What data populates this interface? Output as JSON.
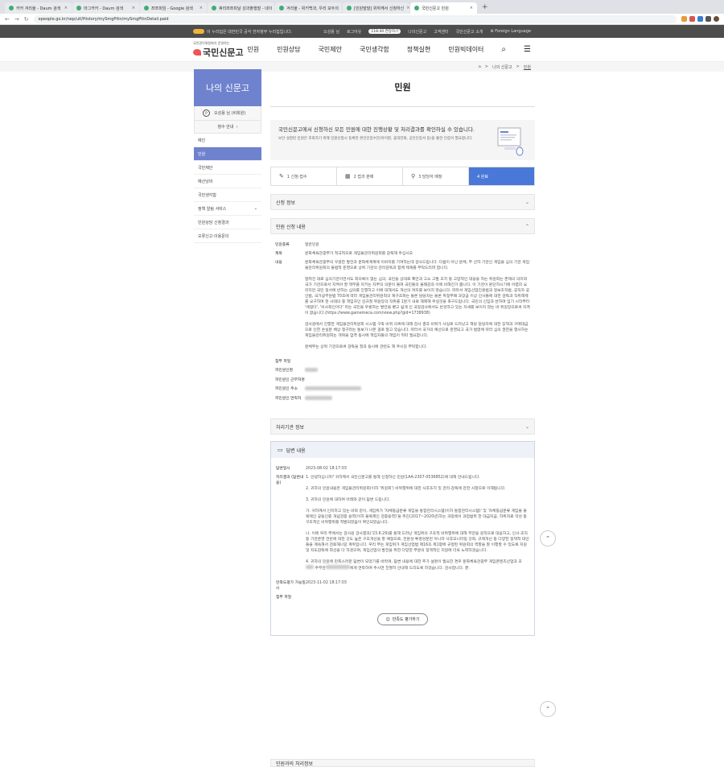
{
  "browser": {
    "tabs": [
      {
        "label": "카카 겨리울 - Daum 검색"
      },
      {
        "label": "마그카카 - Daum 검색"
      },
      {
        "label": "쯔쯔피임 - Google 검색"
      },
      {
        "label": "쿼리쯔쯔피날 성과출행말 - 네이"
      },
      {
        "label": "겨리울 - 위키백과, 우리 모두의"
      },
      {
        "label": "[민원발말] 위하께서 신청하신"
      },
      {
        "label": "국민신문고 민원"
      }
    ],
    "url": "epeople.go.kr/nep/utl/History/mySmgPttn/mySmgPttnDetail.paid"
  },
  "topbar": {
    "notice": "이 누리집은 대한민국 공식 전자정부 누리집입니다.",
    "user": "오성용 님",
    "logout": "로그아웃",
    "timer": "118:40 연장하기",
    "my": "나의신문고",
    "service": "고객센터",
    "intro": "국민신문고 소개",
    "language": "Foreign Language"
  },
  "header": {
    "logo_small": "국민권익위원회가 운영하는",
    "logo_main": "국민신문고",
    "nav": [
      "민원",
      "민원상담",
      "국민제안",
      "국민생각함",
      "정책실현",
      "민원빅데이터"
    ]
  },
  "breadcrumb": {
    "home": "⌂",
    "sep": ">",
    "parent": "나의 신문고",
    "current": "민원"
  },
  "sidebar": {
    "title": "나의 신문고",
    "avatar": "P",
    "user": "오성용 님 (비회원)",
    "guide": "청수 안내",
    "items": [
      {
        "label": "예인"
      },
      {
        "label": "민원"
      },
      {
        "label": "국민제안"
      },
      {
        "label": "예산낭비"
      },
      {
        "label": "국민생각함"
      },
      {
        "label": "정책 알림 서비스"
      },
      {
        "label": "민원상담 신청결과"
      },
      {
        "label": "오류신고·이용문의"
      }
    ]
  },
  "main": {
    "title": "민원",
    "intro_lead": "국민신문고에서 신청하신 모든 민원에 대한 진행상황 및 처리결과를 확인하실 수 있습니다.",
    "intro_sub": "보안 설정된 민원은 조회하기 위해 민원신청시 등록한 본인인증수단(아이핀, 휴대전화, 공인인증서 등)을 통한 인증이 필요합니다.",
    "steps": [
      {
        "label": "1 신청·접수"
      },
      {
        "label": "2 접과 분배"
      },
      {
        "label": "3 담당자 배정"
      },
      {
        "label": "4 완료"
      }
    ],
    "section_apply": "신청 정보",
    "section_content": "민원 신청 내용",
    "fields": {
      "type_k": "민원종류",
      "type_v": "일반민원",
      "subject_k": "제목",
      "subject_v": "문화체육관광부가 적극적으로 게임물관리위원회를 감독해 주십시오",
      "content_k": "내용",
      "content_p1": "문화체육관광부의 꾸꿍한 발전과 문화체계계에 이바지를 기여하는데 감사드립니다. 다름이 아닌 문체, 부 산하 기관인 게임물 심의 기관 게임물관리위원회의 불법적 운영으로 상위 기관의 관리감독과 함께 제재를 부탁드리려 합니다.",
      "content_p2": "알려진 대로 심의기관이면서도 회의록이 없는 심의, 국민을 상대로 폭언과 고소 고발 조치 등 고압적인 대응을 하는 위원회는 존재의 의미와 국가 기관으로서 지켜야 할 책무를 지키는 자부의 의문이 들며 국민들의 불쾌감과 이에 비해진가 봅니다. 이 기관이 판단하시기에 어렵지 요리지만 국민 정서에 반하는 심의를 진행하고 이에 대해서도 개선의 여지를 보이지 않습니다. 따라서 게임산업진흥법과 정보조직법, 공직자 공인법, 국가공무원법 70조에 따라 게임물관리위원회의 재구조화는 물론 담당자는 물론 위정부패 과장급 이상 인사들에 대한 감독과 직위해제를 요구하며 현 사태의 중 책임자인 김규철 위원장의 직위를 1분기 내로 해제해 주실것을 촉구드립니다. 국민의 신임과 반하며 임기 시작부터 '애걸다', '비사회인이다' 라는 국민을 우롱하는 발언을 뱉고 쉽게 인 국정감사에서도 반성하고 있는 자세를 보이지 않는 바 위원장으로써 자격이 없습니다.(https://www.gamemeca.com/view.php?gid=1738938)",
      "content_p3": "감사원에서 진행한 게임물관리위원회 시스템 구축 비위 의혹에 대해 감사 결과 비위가 사실로 드러났고 해당 담당자에 대한 징책과 구매대금으로 인한 손실분 배상 청구라는 통보가 나온 걸로 알고 있습니다. 따라서 국가의 예산으로 운영되고 국가 법령에 따라 심의 권한을 행사하는 게임물관리위원회는 개혁을 엄격 동시에 책임자들의 책임이 뒤따 필요합니다.",
      "content_p4": "문체부는 상위 기관으로써 감독을 철과 동시에 관련도 해 주시길 부탁합니다.",
      "file_k": "첨부 파일",
      "person_k": "피민원인명",
      "org_k": "피민원인 근무처명",
      "addr_k": "피민원인 주소",
      "phone_k": "피민원인 연락처"
    },
    "section_org": "처리기관 정보",
    "answer": {
      "title": "답변 내용",
      "date_k": "답변일시",
      "date_v": "2023-08-02 18:17:03",
      "result_k": "처리결과 (답변내용)",
      "r1": "1. 안녕하십니까? 귀하께서 국민신문고를 통해 신청하신 민원(1AA-2307-0536852)에 대해 안내드립니다.",
      "r2": "2. 귀하의 민원내용은 게임물관리위원회(이하 '위원회') 비위행위에 대한 사후조치 및 관리·감독에 관한 사항으로 이해됩니다.",
      "r3": "3. 귀하의 민원에 대하여 아래와 같이 답변 드립니다.",
      "r4": "가. 귀하께서 인지하고 있는 바와 같이, 게임위가 '자체등급분류 게임물 통합관리시스템(이하 통합관리시스템)' 및 '자체등급분류 게임물 불복제인 공동인증 개념검증 용역(이하 불복제인 검증용역)'을 추진(2017~2020년)하는 과정에서 과업범위 한 대금지급, 하위자료 작성 등 구조적인 비위행위를 적발되었음이 확인되었습니다.",
      "r5": "나. 이에 우리 부에서는 감사원 감사결과('23.6.29)를 통해 드러난 게임위의 구조적 비위행위에 대해 무관용 원칙으로 대응하고, 인사·조직 등 기관운영 전반에 대한 강도 높은 구조개선을 할 예정으로, 전문성·투명성분만 아니라 사후모니터링 강화, 규제개선 등 다양한 정책적 대안들을 계속해서 검토해나갈 계획입니다. 우리 부는 게임위가 게임산업법 제16조 제1항에 규정된 위원회의 역할을 잘 이행할 수 있도록 지원 및 지도감독에 최선을 다 하겠으며, 게임산업의 발전을 위한 다양한 부문의 정책적인 지원에 더욱 노력하겠습니다.",
      "r6a": "4. 귀하의 민원에 만족스러운 답변이 되었기를 바라며, 답변 내용에 대한 추가 설명이 필요한 경우 문화체육관광부 게임콘텐츠산업과 조",
      "r6b": "에게 연락하여 주시면 친절히 안내해 드리도록 하겠습니다. 감사합니다. 끝.",
      "r6c": "주무관",
      "satis_k": "만족도평가 가능일시",
      "satis_v": "2023-11-02 18:17:03",
      "file_k": "첨부 파일",
      "rate_btn": "만족도 평가하기"
    },
    "section_last": "민원과의 처리정보"
  },
  "icons": {
    "search": "search-icon",
    "menu": "hamburger-icon",
    "top": "chevron-up-icon"
  }
}
